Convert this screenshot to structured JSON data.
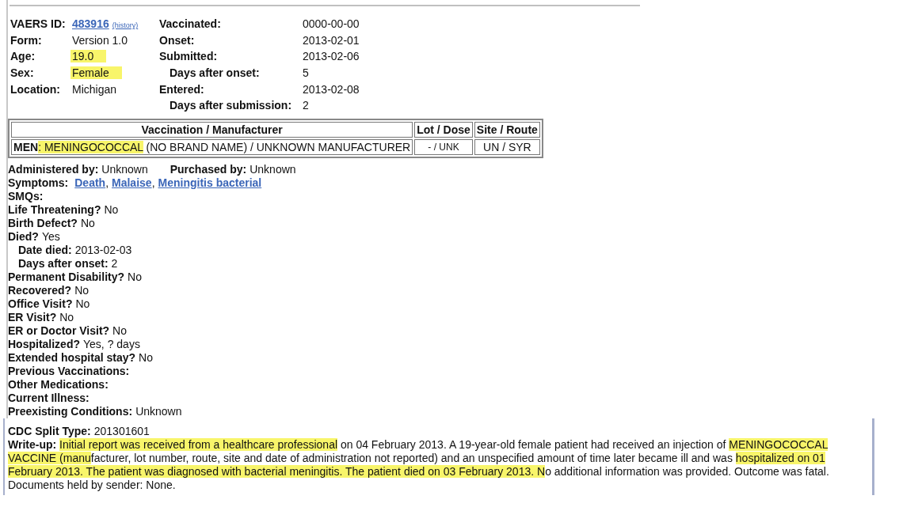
{
  "summary": {
    "left": [
      {
        "kind": "id",
        "label": "VAERS ID:",
        "value": "483916",
        "note": "(history)"
      },
      {
        "kind": "text",
        "label": "Form:",
        "value": "Version 1.0",
        "highlighted": false
      },
      {
        "kind": "text",
        "label": "Age:",
        "value": "19.0",
        "highlighted": true
      },
      {
        "kind": "text",
        "label": "Sex:",
        "value": "Female",
        "highlighted": true
      },
      {
        "kind": "text",
        "label": "Location:",
        "value": "Michigan",
        "highlighted": false
      }
    ],
    "right": [
      {
        "label": "Vaccinated:",
        "value": "0000-00-00"
      },
      {
        "label": "Onset:",
        "value": "2013-02-01"
      },
      {
        "label": "Submitted:",
        "value": "2013-02-06",
        "children": [
          {
            "label": "Days after onset:",
            "value": "5"
          }
        ]
      },
      {
        "label": "Entered:",
        "value": "2013-02-08",
        "children": [
          {
            "label": "Days after submission:",
            "value": "2"
          }
        ]
      }
    ]
  },
  "table": {
    "columns": [
      "Vaccination / Manufacturer",
      "Lot / Dose",
      "Site / Route"
    ],
    "rows": [
      {
        "cells": [
          {
            "kind": "main",
            "segments": [
              {
                "text": "**MEN**",
                "highlighted": false
              },
              {
                "text": ": MENINGOCOCCAL",
                "highlighted": true
              },
              {
                "text": " (NO BRAND NAME) / UNKNOWN MANUFACTURER",
                "highlighted": false
              }
            ]
          },
          {
            "kind": "small",
            "segments": [
              {
                "text": "- / UNK",
                "highlighted": false
              }
            ]
          },
          {
            "kind": "center",
            "segments": [
              {
                "text": "UN / SYR",
                "highlighted": false
              }
            ]
          }
        ]
      }
    ]
  },
  "details": [
    {
      "kind": "pair",
      "parts": [
        {
          "label": "Administered by:",
          "value": "Unknown"
        },
        {
          "label": "Purchased by:",
          "value": "Unknown"
        }
      ]
    },
    {
      "kind": "links",
      "label": "Symptoms:",
      "separator": ",",
      "links": [
        "Death",
        "Malaise",
        "Meningitis bacterial"
      ]
    },
    {
      "kind": "text",
      "label": "SMQs:"
    },
    {
      "kind": "text",
      "label": "Life Threatening?",
      "value": "No"
    },
    {
      "kind": "text",
      "label": "Birth Defect?",
      "value": "No"
    },
    {
      "kind": "text",
      "label": "Died?",
      "value": "Yes",
      "children": [
        {
          "label": "Date died:",
          "value": "2013-02-03"
        },
        {
          "label": "Days after onset:",
          "value": "2"
        }
      ]
    },
    {
      "kind": "text",
      "label": "Permanent Disability?",
      "value": "No"
    },
    {
      "kind": "text",
      "label": "Recovered?",
      "value": "No"
    },
    {
      "kind": "text",
      "label": "Office Visit?",
      "value": "No"
    },
    {
      "kind": "text",
      "label": "ER Visit?",
      "value": "No"
    },
    {
      "kind": "text",
      "label": "ER or Doctor Visit?",
      "value": "No"
    },
    {
      "kind": "text",
      "label": "Hospitalized?",
      "value": "Yes, ? days"
    },
    {
      "kind": "text",
      "label": "Extended hospital stay?",
      "value": "No"
    },
    {
      "kind": "text",
      "label": "Previous Vaccinations:"
    },
    {
      "kind": "text",
      "label": "Other Medications:"
    },
    {
      "kind": "text",
      "label": "Current Illness:"
    },
    {
      "kind": "text",
      "label": "Preexisting Conditions:",
      "value": "Unknown"
    }
  ],
  "report": {
    "split_type": {
      "label": "CDC Split Type:",
      "value": "201301601"
    },
    "write_up": {
      "label": "Write-up:",
      "segments": [
        {
          "text": "Initial report was received from a healthcare professional",
          "highlighted": true
        },
        {
          "text": " on 04 February 2013. A 19-year-old female patient had received an injection of ",
          "highlighted": false
        },
        {
          "text": "MENINGOCOCCAL VACCINE (manu",
          "highlighted": true
        },
        {
          "text": "facturer, lot number, route, site and date of administration not reported) and an unspecified amount of time later became ill and was ",
          "highlighted": false
        },
        {
          "text": "hospitalized on 01 February 2013. The patient was diagnosed with bacterial meningitis. The patient died on 03 February 2013. N",
          "highlighted": true
        },
        {
          "text": "o additional information was provided. Outcome was fatal. Documents held by sender: None.",
          "highlighted": false
        }
      ]
    }
  }
}
